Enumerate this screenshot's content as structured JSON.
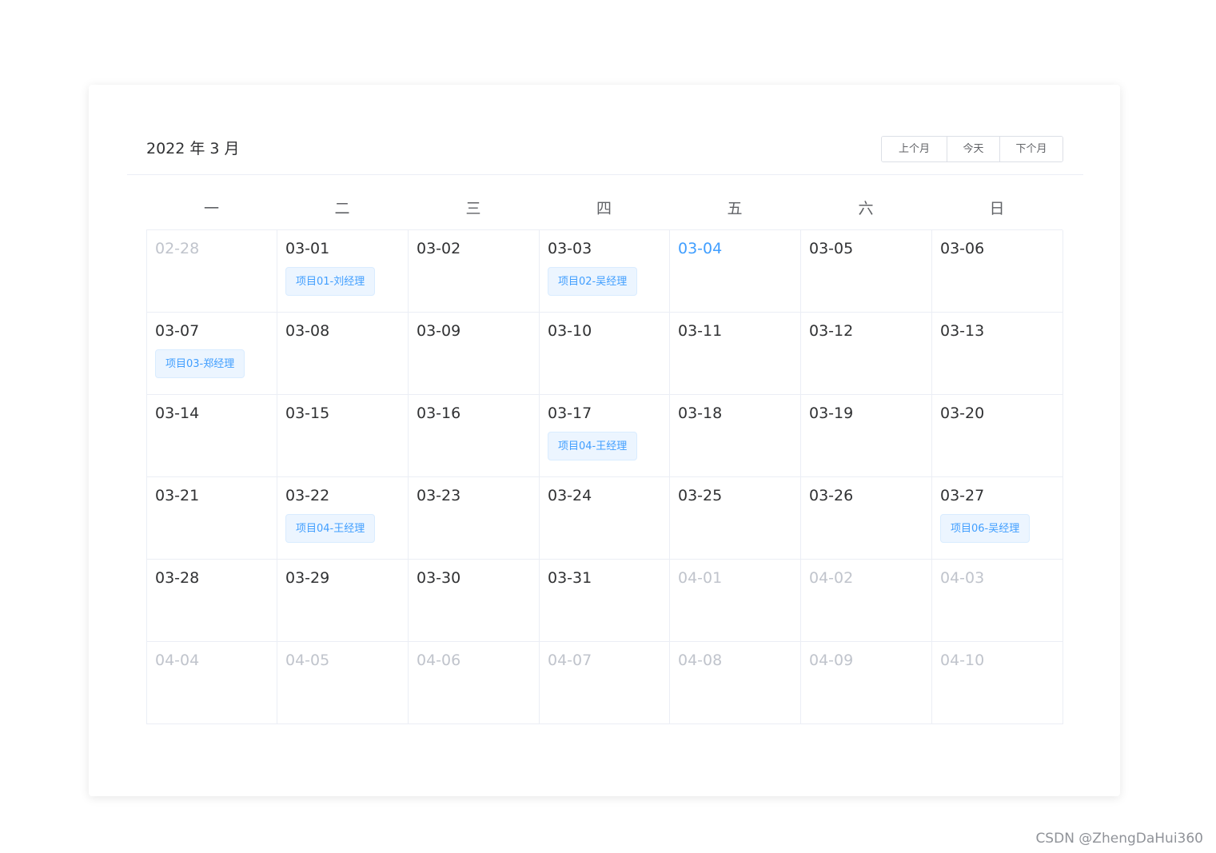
{
  "calendar": {
    "title": "2022 年 3 月",
    "buttons": {
      "prev": "上个月",
      "today": "今天",
      "next": "下个月"
    },
    "weekdays": [
      "一",
      "二",
      "三",
      "四",
      "五",
      "六",
      "日"
    ],
    "today_color": "#409eff",
    "cells": [
      {
        "date": "02-28",
        "state": "other",
        "event": ""
      },
      {
        "date": "03-01",
        "state": "current",
        "event": "项目01-刘经理"
      },
      {
        "date": "03-02",
        "state": "current",
        "event": ""
      },
      {
        "date": "03-03",
        "state": "current",
        "event": "项目02-吴经理"
      },
      {
        "date": "03-04",
        "state": "today",
        "event": ""
      },
      {
        "date": "03-05",
        "state": "current",
        "event": ""
      },
      {
        "date": "03-06",
        "state": "current",
        "event": ""
      },
      {
        "date": "03-07",
        "state": "current",
        "event": "项目03-郑经理"
      },
      {
        "date": "03-08",
        "state": "current",
        "event": ""
      },
      {
        "date": "03-09",
        "state": "current",
        "event": ""
      },
      {
        "date": "03-10",
        "state": "current",
        "event": ""
      },
      {
        "date": "03-11",
        "state": "current",
        "event": ""
      },
      {
        "date": "03-12",
        "state": "current",
        "event": ""
      },
      {
        "date": "03-13",
        "state": "current",
        "event": ""
      },
      {
        "date": "03-14",
        "state": "current",
        "event": ""
      },
      {
        "date": "03-15",
        "state": "current",
        "event": ""
      },
      {
        "date": "03-16",
        "state": "current",
        "event": ""
      },
      {
        "date": "03-17",
        "state": "current",
        "event": "项目04-王经理"
      },
      {
        "date": "03-18",
        "state": "current",
        "event": ""
      },
      {
        "date": "03-19",
        "state": "current",
        "event": ""
      },
      {
        "date": "03-20",
        "state": "current",
        "event": ""
      },
      {
        "date": "03-21",
        "state": "current",
        "event": ""
      },
      {
        "date": "03-22",
        "state": "current",
        "event": "项目04-王经理"
      },
      {
        "date": "03-23",
        "state": "current",
        "event": ""
      },
      {
        "date": "03-24",
        "state": "current",
        "event": ""
      },
      {
        "date": "03-25",
        "state": "current",
        "event": ""
      },
      {
        "date": "03-26",
        "state": "current",
        "event": ""
      },
      {
        "date": "03-27",
        "state": "current",
        "event": "项目06-吴经理"
      },
      {
        "date": "03-28",
        "state": "current",
        "event": ""
      },
      {
        "date": "03-29",
        "state": "current",
        "event": ""
      },
      {
        "date": "03-30",
        "state": "current",
        "event": ""
      },
      {
        "date": "03-31",
        "state": "current",
        "event": ""
      },
      {
        "date": "04-01",
        "state": "other",
        "event": ""
      },
      {
        "date": "04-02",
        "state": "other",
        "event": ""
      },
      {
        "date": "04-03",
        "state": "other",
        "event": ""
      },
      {
        "date": "04-04",
        "state": "other",
        "event": ""
      },
      {
        "date": "04-05",
        "state": "other",
        "event": ""
      },
      {
        "date": "04-06",
        "state": "other",
        "event": ""
      },
      {
        "date": "04-07",
        "state": "other",
        "event": ""
      },
      {
        "date": "04-08",
        "state": "other",
        "event": ""
      },
      {
        "date": "04-09",
        "state": "other",
        "event": ""
      },
      {
        "date": "04-10",
        "state": "other",
        "event": ""
      }
    ]
  },
  "watermark": "CSDN @ZhengDaHui360"
}
